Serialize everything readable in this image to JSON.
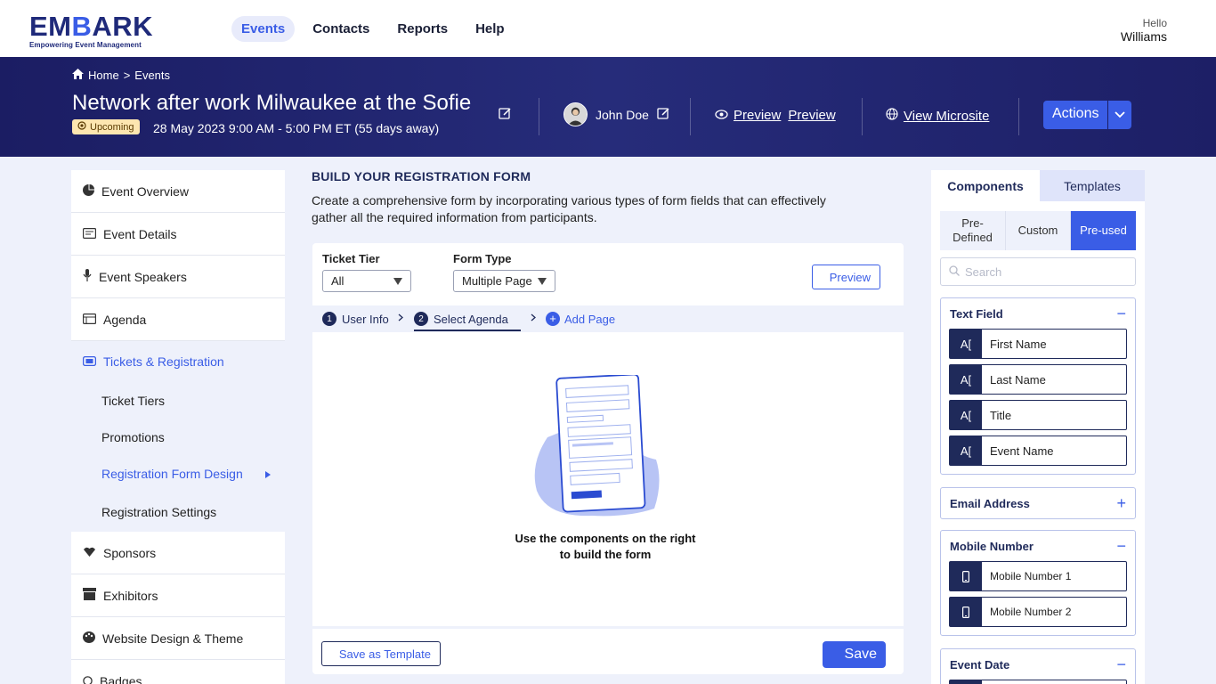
{
  "brand": {
    "name_part1": "EM",
    "name_part2": "B",
    "name_part3": "ARK",
    "tagline": "Empowering Event Management"
  },
  "nav": {
    "items": [
      "Events",
      "Contacts",
      "Reports",
      "Help"
    ],
    "active": "Events"
  },
  "user": {
    "greeting": "Hello",
    "name": "Williams"
  },
  "banner": {
    "breadcrumb_home": "Home",
    "breadcrumb_sep": ">",
    "breadcrumb_current": "Events",
    "title": "Network after work Milwaukee at the Sofie",
    "status": "Upcoming",
    "date": "28 May 2023 9:00 AM - 5:00 PM ET (55 days away)",
    "owner": "John Doe",
    "preview_label_1": "Preview",
    "preview_label_2": "Preview",
    "microsite_label": "View Microsite",
    "actions_label": "Actions"
  },
  "sidebar": {
    "items": [
      {
        "label": "Event Overview"
      },
      {
        "label": "Event Details"
      },
      {
        "label": "Event Speakers"
      },
      {
        "label": "Agenda"
      }
    ],
    "group": {
      "label": "Tickets & Registration",
      "subitems": [
        {
          "label": "Ticket Tiers"
        },
        {
          "label": "Promotions"
        },
        {
          "label": "Registration Form Design"
        },
        {
          "label": "Registration Settings"
        }
      ]
    },
    "items_after": [
      {
        "label": "Sponsors"
      },
      {
        "label": "Exhibitors"
      },
      {
        "label": "Website Design & Theme"
      },
      {
        "label": "Badges"
      }
    ]
  },
  "main": {
    "title": "BUILD YOUR REGISTRATION FORM",
    "description": "Create a comprehensive form by incorporating various types of form fields that can effectively gather all the required information from participants.",
    "ticket_tier_label": "Ticket Tier",
    "ticket_tier_value": "All",
    "form_type_label": "Form Type",
    "form_type_value": "Multiple Page",
    "preview_button": "Preview",
    "steps": [
      {
        "num": "1",
        "label": "User Info"
      },
      {
        "num": "2",
        "label": "Select Agenda"
      }
    ],
    "add_page": "Add Page",
    "add_page_symbol": "+",
    "empty_text": "Use the components on the right to build the form",
    "save_template": "Save as Template",
    "save": "Save"
  },
  "right_panel": {
    "tabs": [
      "Components",
      "Templates"
    ],
    "segments": [
      "Pre-Defined",
      "Custom",
      "Pre-used"
    ],
    "active_segment": "Pre-used",
    "search_placeholder": "Search",
    "groups": [
      {
        "title": "Text Field",
        "toggle": "−",
        "items": [
          "First Name",
          "Last Name",
          "Title",
          "Event Name"
        ]
      },
      {
        "title": "Email Address",
        "toggle": "+",
        "items": []
      },
      {
        "title": "Mobile Number",
        "toggle": "−",
        "items": [
          "Mobile Number 1",
          "Mobile Number 2"
        ]
      },
      {
        "title": "Event Date",
        "toggle": "−",
        "items": []
      }
    ]
  },
  "colors": {
    "primary": "#3a5de6",
    "navy": "#1f2a5a",
    "banner": "#1b1d63",
    "bg": "#eef1fb",
    "badge": "#fde6b0"
  }
}
